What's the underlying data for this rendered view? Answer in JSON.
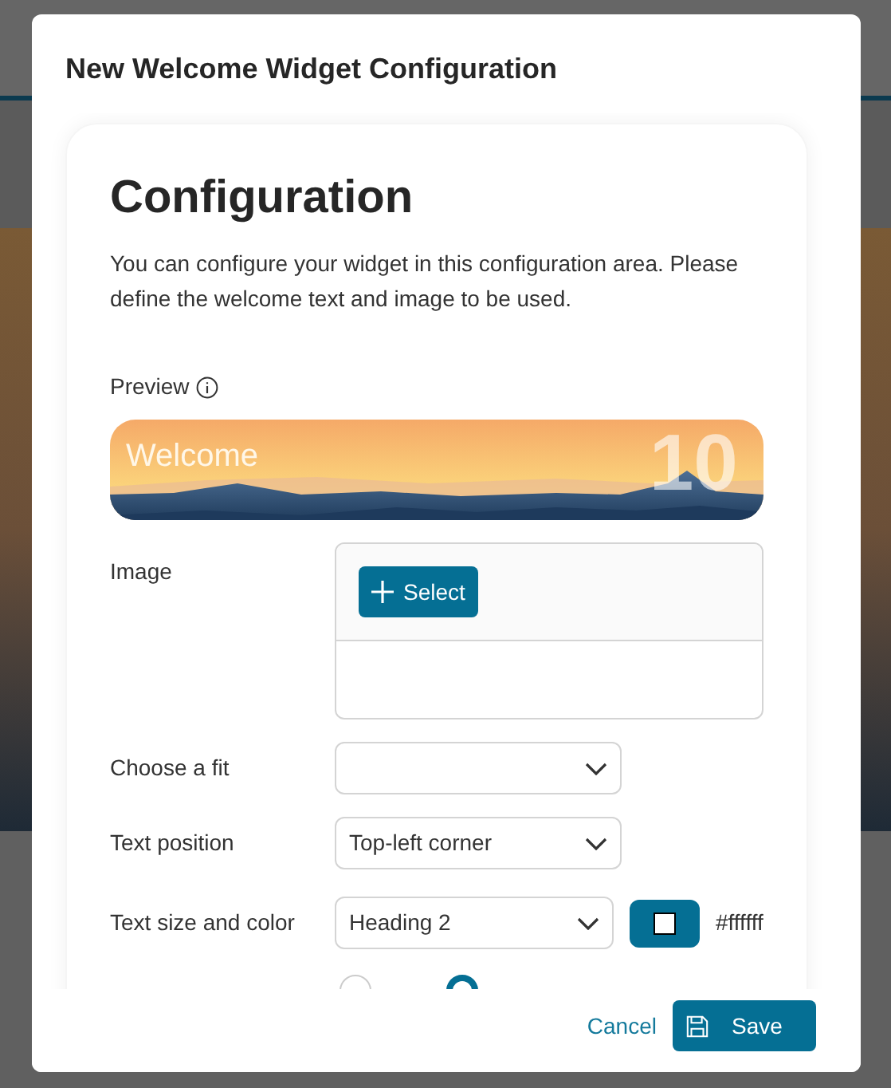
{
  "dialog": {
    "title": "New Welcome Widget Configuration"
  },
  "card": {
    "heading": "Configuration",
    "description": "You can configure your widget in this configuration area. Please define the welcome text and image to be used."
  },
  "preview": {
    "label": "Preview",
    "welcome_text": "Welcome",
    "badge_text": "10"
  },
  "fields": [
    {
      "kind": "image",
      "label": "Image",
      "button": "Select"
    },
    {
      "kind": "select",
      "label": "Choose a fit"
    },
    {
      "kind": "select",
      "label": "Text position",
      "value": "Top-left corner"
    },
    {
      "kind": "select_color",
      "label": "Text size and color",
      "value": "Heading 2",
      "color": "#ffffff",
      "color_text": "#ffffff"
    },
    {
      "kind": "radio",
      "options": [
        {
          "selected": false
        },
        {
          "selected": true
        }
      ]
    }
  ],
  "footer": {
    "cancel": "Cancel",
    "save": "Save"
  }
}
